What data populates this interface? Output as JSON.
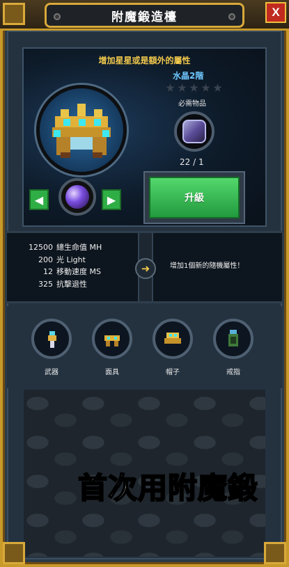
{
  "window": {
    "title": "附魔鍛造檯",
    "close_label": "X"
  },
  "forge": {
    "subtitle": "增加星星或是額外的屬性",
    "crystal_label": "水晶2階",
    "stars_filled": 0,
    "stars_total": 5,
    "required_label": "必需物品",
    "material_count": "22 / 1",
    "upgrade_label": "升級",
    "prev_icon": "chevron-left-icon",
    "next_icon": "chevron-right-icon"
  },
  "stats": {
    "rows": [
      {
        "value": "12500",
        "label": "總生命值 MH"
      },
      {
        "value": "200",
        "label": "光 Light"
      },
      {
        "value": "12",
        "label": "移動速度 MS"
      },
      {
        "value": "325",
        "label": "抗擊退性"
      }
    ],
    "result_text": "增加1個新的隨機屬性！"
  },
  "equipment": {
    "tabs": [
      {
        "label": "武器",
        "icon": "weapon-icon"
      },
      {
        "label": "面具",
        "icon": "mask-icon"
      },
      {
        "label": "帽子",
        "icon": "hat-icon"
      },
      {
        "label": "戒指",
        "icon": "ring-icon"
      }
    ]
  },
  "overlay": {
    "caption": "首次用附魔鍛"
  },
  "colors": {
    "gold": "#c89a2a",
    "accent_green": "#2fae46",
    "crystal_blue": "#6fc7ff",
    "subtitle_yellow": "#f2c94c"
  }
}
